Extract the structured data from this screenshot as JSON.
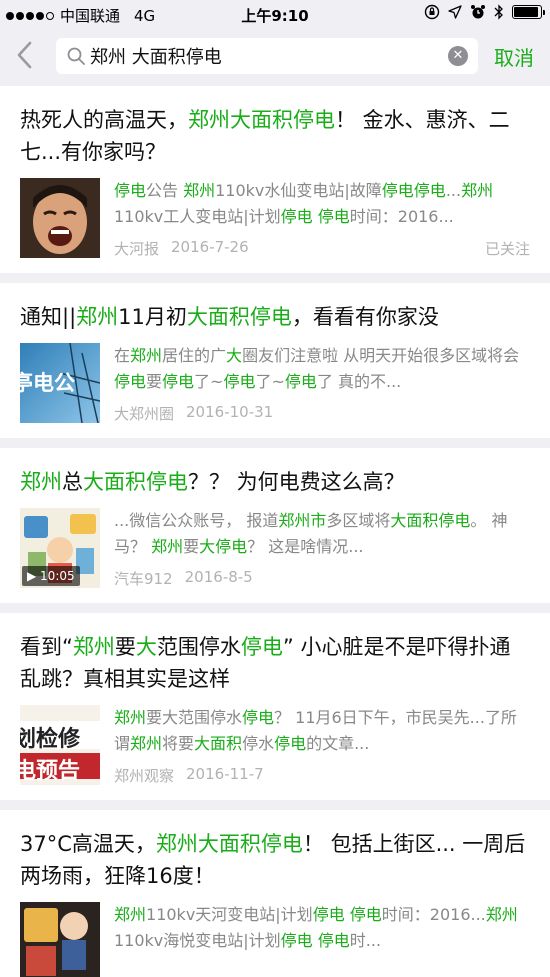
{
  "status_bar": {
    "carrier": "中国联通",
    "network": "4G",
    "time": "上午9:10"
  },
  "search": {
    "query": "郑州 大面积停电",
    "cancel_label": "取消"
  },
  "results": [
    {
      "title": [
        {
          "t": "热死人的高温天，",
          "h": false
        },
        {
          "t": "郑州大面积停电",
          "h": true
        },
        {
          "t": "！ 金水、惠济、二七...有你家吗？",
          "h": false
        }
      ],
      "snippet": [
        {
          "t": "停电",
          "h": true
        },
        {
          "t": "公告 ",
          "h": false
        },
        {
          "t": "郑州",
          "h": true
        },
        {
          "t": "110kv水仙变电站|故障",
          "h": false
        },
        {
          "t": "停电停电",
          "h": true
        },
        {
          "t": "...",
          "h": false
        },
        {
          "t": "郑州",
          "h": true
        },
        {
          "t": "110kv工人变电站|计划",
          "h": false
        },
        {
          "t": "停电 停电",
          "h": true
        },
        {
          "t": "时间：2016...",
          "h": false
        }
      ],
      "source": "大河报",
      "date": "2016-7-26",
      "status": "已关注",
      "thumb_style": "face",
      "video_duration": ""
    },
    {
      "title": [
        {
          "t": "通知||",
          "h": false
        },
        {
          "t": "郑州",
          "h": true
        },
        {
          "t": "11月初",
          "h": false
        },
        {
          "t": "大面积停电",
          "h": true
        },
        {
          "t": "，看看有你家没",
          "h": false
        }
      ],
      "snippet": [
        {
          "t": "在",
          "h": false
        },
        {
          "t": "郑州",
          "h": true
        },
        {
          "t": "居住的广",
          "h": false
        },
        {
          "t": "大",
          "h": true
        },
        {
          "t": "圈友们注意啦 从明天开始很多区域将会",
          "h": false
        },
        {
          "t": "停电",
          "h": true
        },
        {
          "t": "要",
          "h": false
        },
        {
          "t": "停电",
          "h": true
        },
        {
          "t": "了~",
          "h": false
        },
        {
          "t": "停电",
          "h": true
        },
        {
          "t": "了~",
          "h": false
        },
        {
          "t": "停电",
          "h": true
        },
        {
          "t": "了 真的不...",
          "h": false
        }
      ],
      "source": "大郑州圈",
      "date": "2016-10-31",
      "status": "",
      "thumb_style": "power",
      "thumb_text": "亭电公",
      "video_duration": ""
    },
    {
      "title": [
        {
          "t": "郑州",
          "h": true
        },
        {
          "t": "总",
          "h": false
        },
        {
          "t": "大面积停电",
          "h": true
        },
        {
          "t": "？？ 为何电费这么高？",
          "h": false
        }
      ],
      "snippet": [
        {
          "t": "...微信公众账号， 报道",
          "h": false
        },
        {
          "t": "郑州",
          "h": true
        },
        {
          "t": "市",
          "h": true
        },
        {
          "t": "多区域将",
          "h": false
        },
        {
          "t": "大面积停电",
          "h": true
        },
        {
          "t": "。 神马？ ",
          "h": false
        },
        {
          "t": "郑州",
          "h": true
        },
        {
          "t": "要",
          "h": false
        },
        {
          "t": "大停电",
          "h": true
        },
        {
          "t": "？ 这是啥情况...",
          "h": false
        }
      ],
      "source": "汽车912",
      "date": "2016-8-5",
      "status": "",
      "thumb_style": "cartoon",
      "video_duration": "10:05"
    },
    {
      "title": [
        {
          "t": "看到“",
          "h": false
        },
        {
          "t": "郑州",
          "h": true
        },
        {
          "t": "要",
          "h": false
        },
        {
          "t": "大",
          "h": true
        },
        {
          "t": "范围停水",
          "h": false
        },
        {
          "t": "停电",
          "h": true
        },
        {
          "t": "” 小心脏是不是吓得扑通乱跳？真相其实是这样",
          "h": false
        }
      ],
      "snippet": [
        {
          "t": "郑州",
          "h": true
        },
        {
          "t": "要大范围停水",
          "h": false
        },
        {
          "t": "停电",
          "h": true
        },
        {
          "t": "？ 11月6日下午，市民吴先...了所谓",
          "h": false
        },
        {
          "t": "郑州",
          "h": true
        },
        {
          "t": "将要",
          "h": false
        },
        {
          "t": "大面积",
          "h": true
        },
        {
          "t": "停水",
          "h": false
        },
        {
          "t": "停电",
          "h": true
        },
        {
          "t": "的文章...",
          "h": false
        }
      ],
      "source": "郑州观察",
      "date": "2016-11-7",
      "status": "",
      "thumb_style": "notice",
      "thumb_text_1": "划检修",
      "thumb_text_2": "电预告",
      "video_duration": ""
    },
    {
      "title": [
        {
          "t": "37°C高温天，",
          "h": false
        },
        {
          "t": "郑州大面积停电",
          "h": true
        },
        {
          "t": "！ 包括上街区... 一周后两场雨，狂降16度！",
          "h": false
        }
      ],
      "snippet": [
        {
          "t": "郑州",
          "h": true
        },
        {
          "t": "110kv天河变电站|计划",
          "h": false
        },
        {
          "t": "停电 停电",
          "h": true
        },
        {
          "t": "时间：2016...",
          "h": false
        },
        {
          "t": "郑州",
          "h": true
        },
        {
          "t": "110kv海悦变电站|计划",
          "h": false
        },
        {
          "t": "停电 停电",
          "h": true
        },
        {
          "t": "时...",
          "h": false
        }
      ],
      "source": "",
      "date": "",
      "status": "",
      "thumb_style": "dark",
      "video_duration": ""
    }
  ]
}
